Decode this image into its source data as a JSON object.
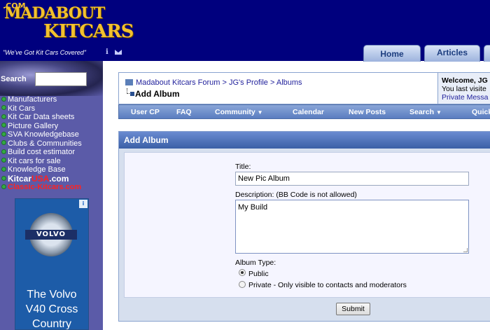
{
  "header": {
    "logo_line1": "MADABOUT",
    "logo_line2": "KITCARS",
    "logo_domain": ".COM",
    "tagline": "\"We've Got Kit Cars Covered\"",
    "tabs": [
      {
        "label": "Home"
      },
      {
        "label": "Articles"
      }
    ]
  },
  "sidebar": {
    "search_label": "Search",
    "nav_items": [
      {
        "label": "Manufacturers"
      },
      {
        "label": "Kit Cars"
      },
      {
        "label": "Kit Car Data sheets"
      },
      {
        "label": "Picture Gallery"
      },
      {
        "label": "SVA Knowledgebase"
      },
      {
        "label": "Clubs & Communities"
      },
      {
        "label": "Build cost estimator"
      },
      {
        "label": "Kit cars for sale"
      },
      {
        "label": "Knowledge Base"
      }
    ],
    "kitcar_usa": {
      "part1": "Kitcar",
      "part2": "USA",
      "part3": ".com"
    },
    "classic": "Classic-Kitcars.com",
    "ad": {
      "brand": "VOLVO",
      "lines": [
        "The Volvo",
        "V40 Cross",
        "Country"
      ],
      "badge": "i"
    }
  },
  "breadcrumb": {
    "items": [
      "Madabout Kitcars Forum",
      "JG's Profile",
      "Albums"
    ],
    "separator": ">",
    "current": "Add Album"
  },
  "welcome": {
    "line1": "Welcome, JG",
    "line2": "You last visite",
    "line3": "Private Messa"
  },
  "navbar": {
    "items": [
      "User CP",
      "FAQ",
      "Community",
      "Calendar",
      "New Posts",
      "Search",
      "Quick"
    ]
  },
  "panel": {
    "title": "Add Album",
    "title_label": "Title:",
    "title_value": "New Pic Album",
    "description_label": "Description: (BB Code is not allowed)",
    "description_value": "My Build",
    "album_type_label": "Album Type:",
    "options": [
      "Public",
      "Private - Only visible to contacts and moderators"
    ],
    "selected": "Public",
    "submit_label": "Submit"
  },
  "colors": {
    "header_bg": "#00007e",
    "sidebar_bg": "#5b5ba8",
    "accent": "#3a5fa6",
    "logo_gold": "#f2c12e"
  }
}
